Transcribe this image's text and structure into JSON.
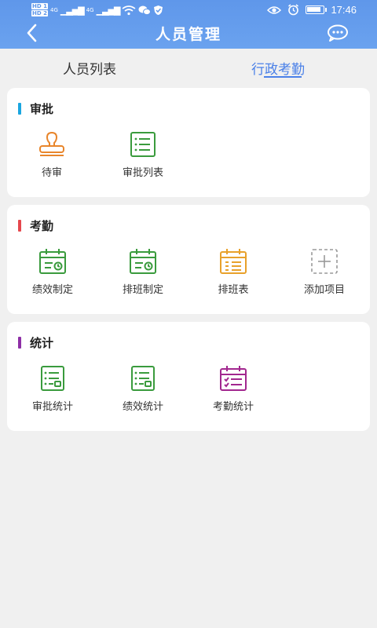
{
  "status_bar": {
    "sim1": "HD 1",
    "sim2": "HD 2",
    "net1": "4G",
    "net2": "4G",
    "battery_level": 0.9,
    "time": "17:46"
  },
  "header": {
    "title": "人员管理"
  },
  "tabs": [
    {
      "label": "人员列表",
      "active": false
    },
    {
      "label": "行政考勤",
      "active": true
    }
  ],
  "sections": [
    {
      "title": "审批",
      "accent": "#1aa6e0",
      "items": [
        {
          "label": "待审",
          "icon": "stamp-icon",
          "color": "#e8852b"
        },
        {
          "label": "审批列表",
          "icon": "list-icon",
          "color": "#3a9b3d"
        }
      ]
    },
    {
      "title": "考勤",
      "accent": "#e5484d",
      "items": [
        {
          "label": "绩效制定",
          "icon": "calendar-clock-icon",
          "color": "#3a9b3d"
        },
        {
          "label": "排班制定",
          "icon": "calendar-clock-icon",
          "color": "#3a9b3d"
        },
        {
          "label": "排班表",
          "icon": "calendar-list-icon",
          "color": "#e8a12b"
        },
        {
          "label": "添加项目",
          "icon": "add-icon",
          "color": "#999999"
        }
      ]
    },
    {
      "title": "统计",
      "accent": "#8e2fa6",
      "items": [
        {
          "label": "审批统计",
          "icon": "stats-list-icon",
          "color": "#3a9b3d"
        },
        {
          "label": "绩效统计",
          "icon": "stats-list-icon",
          "color": "#3a9b3d"
        },
        {
          "label": "考勤统计",
          "icon": "calendar-check-icon",
          "color": "#a2278f"
        }
      ]
    }
  ]
}
